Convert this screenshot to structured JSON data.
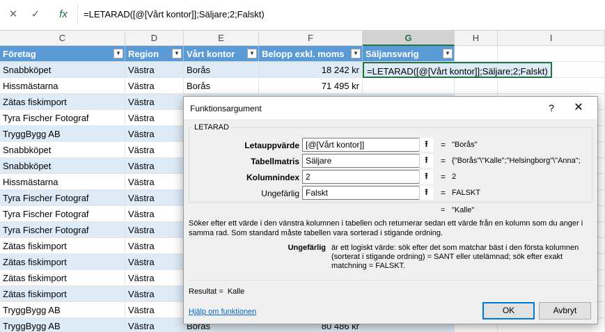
{
  "formula_bar": {
    "cancel_icon": "close-icon",
    "confirm_icon": "check-icon",
    "fx_label": "fx",
    "formula": "=LETARAD([@[Vårt kontor]];Säljare;2;Falskt)"
  },
  "columns": [
    "C",
    "D",
    "E",
    "F",
    "G",
    "H",
    "I"
  ],
  "selected_column": "G",
  "table": {
    "headers": [
      "Företag",
      "Region",
      "Vårt kontor",
      "Belopp exkl. moms",
      "Säljansvarig"
    ],
    "rows": [
      {
        "c": "Snabbköpet",
        "d": "Västra",
        "e": "Borås",
        "f": "18 242 kr",
        "g": ""
      },
      {
        "c": "Hissmästarna",
        "d": "Västra",
        "e": "Borås",
        "f": "71 495 kr",
        "g": ""
      },
      {
        "c": "Zätas fiskimport",
        "d": "Västra",
        "e": "",
        "f": "",
        "g": ""
      },
      {
        "c": "Tyra Fischer Fotograf",
        "d": "Västra",
        "e": "",
        "f": "",
        "g": ""
      },
      {
        "c": "TryggBygg AB",
        "d": "Västra",
        "e": "",
        "f": "",
        "g": ""
      },
      {
        "c": "Snabbköpet",
        "d": "Västra",
        "e": "",
        "f": "",
        "g": ""
      },
      {
        "c": "Snabbköpet",
        "d": "Västra",
        "e": "",
        "f": "",
        "g": ""
      },
      {
        "c": "Hissmästarna",
        "d": "Västra",
        "e": "",
        "f": "",
        "g": ""
      },
      {
        "c": "Tyra Fischer Fotograf",
        "d": "Västra",
        "e": "",
        "f": "",
        "g": ""
      },
      {
        "c": "Tyra Fischer Fotograf",
        "d": "Västra",
        "e": "",
        "f": "",
        "g": ""
      },
      {
        "c": "Tyra Fischer Fotograf",
        "d": "Västra",
        "e": "",
        "f": "",
        "g": ""
      },
      {
        "c": "Zätas fiskimport",
        "d": "Västra",
        "e": "",
        "f": "",
        "g": ""
      },
      {
        "c": "Zätas fiskimport",
        "d": "Västra",
        "e": "",
        "f": "",
        "g": ""
      },
      {
        "c": "Zätas fiskimport",
        "d": "Västra",
        "e": "",
        "f": "",
        "g": ""
      },
      {
        "c": "Zätas fiskimport",
        "d": "Västra",
        "e": "",
        "f": "",
        "g": ""
      },
      {
        "c": "TryggBygg AB",
        "d": "Västra",
        "e": "",
        "f": "",
        "g": ""
      },
      {
        "c": "TryggBygg AB",
        "d": "Västra",
        "e": "Borås",
        "f": "80 486 kr",
        "g": ""
      }
    ],
    "edit_text": "=LETARAD([@[Vårt kontor]];Säljare;2;Falskt)"
  },
  "dialog": {
    "title": "Funktionsargument",
    "help_label": "?",
    "function_name": "LETARAD",
    "args": [
      {
        "label": "Letauppvärde",
        "bold": true,
        "input": "[@[Vårt kontor]]",
        "eq": "=",
        "value": "\"Borås\""
      },
      {
        "label": "Tabellmatris",
        "bold": true,
        "input": "Säljare",
        "eq": "=",
        "value": "{\"Borås\"\\\"Kalle\";\"Helsingborg\"\\\"Anna\";"
      },
      {
        "label": "Kolumnindex",
        "bold": true,
        "input": "2",
        "eq": "=",
        "value": "2"
      },
      {
        "label": "Ungefärlig",
        "bold": false,
        "input": "Falskt",
        "eq": "=",
        "value": "FALSKT"
      }
    ],
    "result_eq": "=",
    "result_preview": "\"Kalle\"",
    "description": "Söker efter ett värde i den vänstra kolumnen i tabellen och returnerar sedan ett värde från en kolumn som du anger i samma rad. Som standard måste tabellen vara sorterad i stigande ordning.",
    "arg_desc_label": "Ungefärlig",
    "arg_desc": "är ett logiskt värde: sök efter det som matchar bäst i den första kolumnen (sorterat i stigande ordning) = SANT eller utelämnad; sök efter exakt matchning = FALSKT.",
    "result_label": "Resultat =",
    "result_value": "Kalle",
    "help_link": "Hjälp om funktionen",
    "ok_label": "OK",
    "cancel_label": "Avbryt"
  }
}
